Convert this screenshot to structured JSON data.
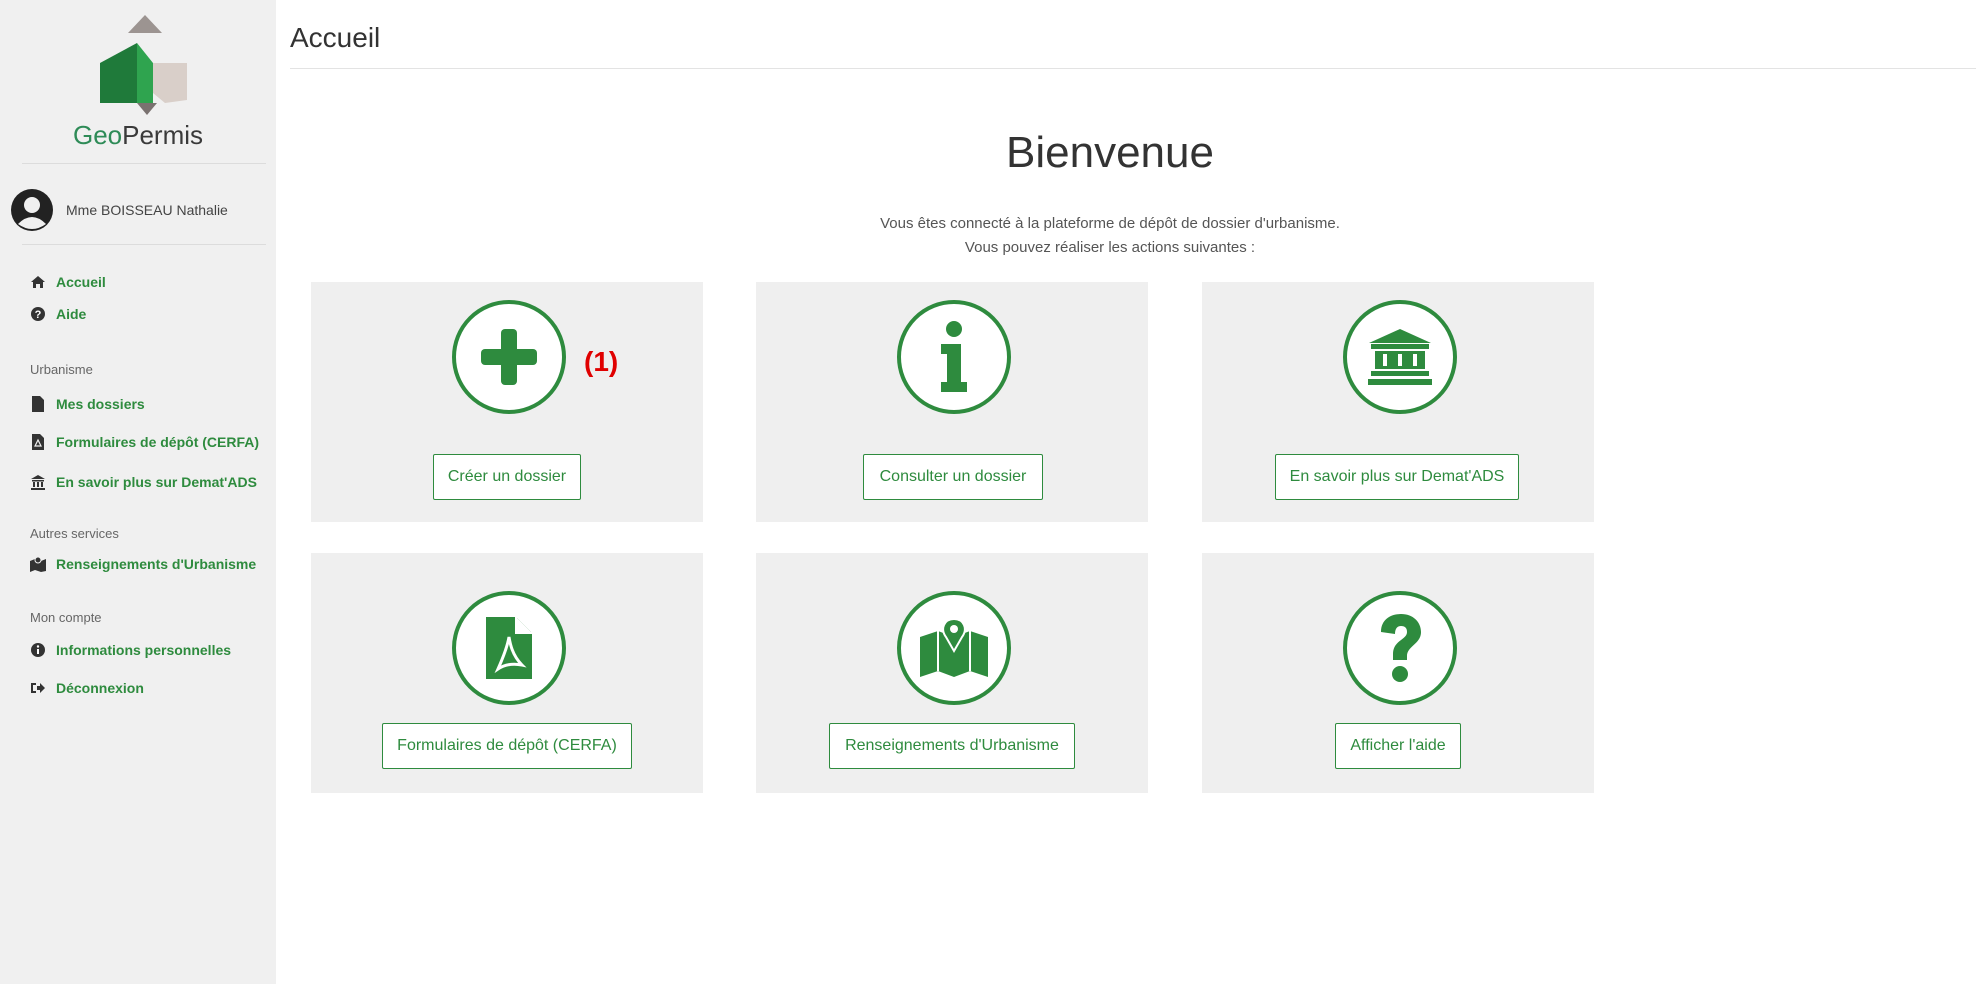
{
  "brand": {
    "geo": "Geo",
    "permis": "Permis"
  },
  "user": {
    "name": "Mme BOISSEAU Nathalie"
  },
  "nav": {
    "accueil": "Accueil",
    "aide": "Aide",
    "section_urbanisme": "Urbanisme",
    "mes_dossiers": "Mes dossiers",
    "formulaires": "Formulaires de dépôt (CERFA)",
    "en_savoir": "En savoir plus sur Demat'ADS",
    "section_autres": "Autres services",
    "renseignements": "Renseignements d'Urbanisme",
    "section_compte": "Mon compte",
    "infos": "Informations personnelles",
    "deconnexion": "Déconnexion"
  },
  "header": {
    "title": "Accueil"
  },
  "main": {
    "welcome": "Bienvenue",
    "intro_line1": "Vous êtes connecté à la plateforme de dépôt de dossier d'urbanisme.",
    "intro_line2": "Vous pouvez réaliser les actions suivantes :",
    "callout": "(1)"
  },
  "cards": {
    "creer": {
      "label": "Créer un dossier",
      "icon": "plus-icon"
    },
    "consulter": {
      "label": "Consulter un dossier",
      "icon": "info-icon"
    },
    "savoir": {
      "label": "En savoir plus sur Demat'ADS",
      "icon": "bank-icon"
    },
    "formulaires": {
      "label": "Formulaires de dépôt (CERFA)",
      "icon": "pdf-file-icon"
    },
    "renseignements": {
      "label": "Renseignements d'Urbanisme",
      "icon": "map-icon"
    },
    "aide": {
      "label": "Afficher l'aide",
      "icon": "question-icon"
    }
  },
  "colors": {
    "accent": "#2e8b3e",
    "callout": "#e00000",
    "card_bg": "#efefef",
    "sidebar_bg": "#f0f0f0"
  }
}
